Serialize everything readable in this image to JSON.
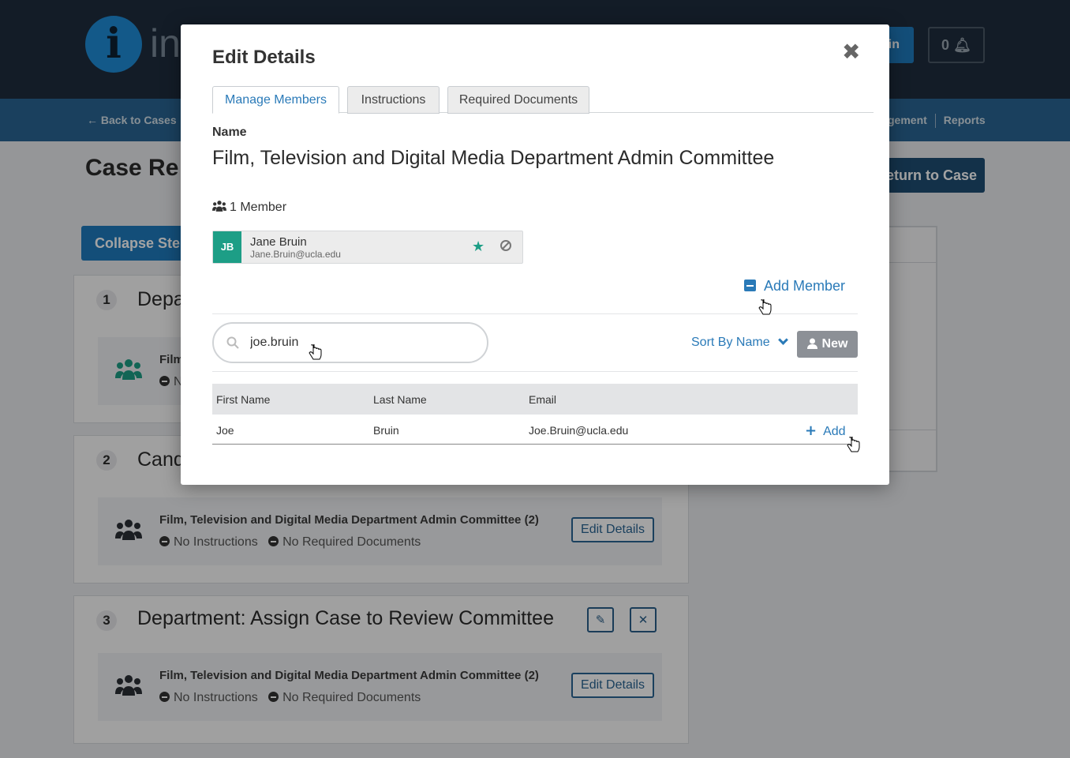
{
  "app": {
    "logo_text": "in",
    "top_button_label": "in",
    "notification_count": "0",
    "back_link": "Back to Cases",
    "nav_right": [
      "gement",
      "Reports"
    ],
    "page_title": "Case Re",
    "return_button": "Return to Case",
    "collapse_button": "Collapse Steps"
  },
  "steps": [
    {
      "number": "1",
      "title": "Depa",
      "committee_name": "Film",
      "meta": "N"
    },
    {
      "number": "2",
      "title": "Cand",
      "committee_name": "Film, Television and Digital Media Department Admin Committee (2)",
      "instructions": "No Instructions",
      "documents": "No Required Documents",
      "edit_button": "Edit Details"
    },
    {
      "number": "3",
      "title": "Department: Assign Case to Review Committee",
      "committee_name": "Film, Television and Digital Media Department Admin Committee (2)",
      "instructions": "No Instructions",
      "documents": "No Required Documents",
      "edit_button": "Edit Details",
      "edit_icon": "pencil-icon",
      "delete_icon": "close-icon"
    }
  ],
  "modal": {
    "title": "Edit Details",
    "tabs": [
      {
        "label": "Manage Members",
        "active": true
      },
      {
        "label": "Instructions",
        "active": false
      },
      {
        "label": "Required Documents",
        "active": false
      }
    ],
    "name_label": "Name",
    "name_value": "Film, Television and Digital Media Department Admin Committee",
    "member_count": "1 Member",
    "members": [
      {
        "initials": "JB",
        "name": "Jane Bruin",
        "email": "Jane.Bruin@ucla.edu",
        "starred": true
      }
    ],
    "add_member_label": "Add Member",
    "search": {
      "value": "joe.bruin",
      "placeholder": ""
    },
    "sort_label": "Sort By Name",
    "new_button": "New",
    "results": {
      "columns": [
        "First Name",
        "Last Name",
        "Email"
      ],
      "rows": [
        {
          "first": "Joe",
          "last": "Bruin",
          "email": "Joe.Bruin@ucla.edu",
          "action": "Add"
        }
      ]
    }
  },
  "colors": {
    "accent": "#2a7ab8",
    "avatar": "#1d9e86",
    "header": "#1f2d3d",
    "subnav": "#2a6593"
  }
}
